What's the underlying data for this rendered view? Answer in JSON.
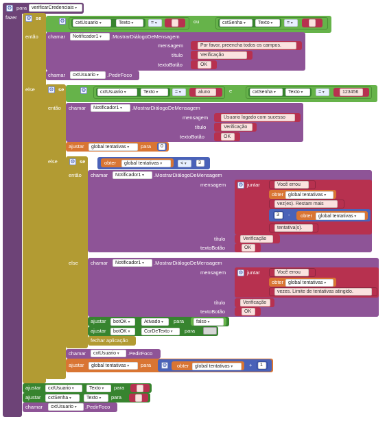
{
  "kw": {
    "para": "para",
    "fazer": "fazer",
    "se": "se",
    "entao": "então",
    "senao": "else",
    "chamar": "chamar",
    "ajustar": "ajustar",
    "obter": "obter",
    "juntar": "juntar",
    "mensagem": "mensagem",
    "titulo": "título",
    "textoBotao": "textoBotão",
    "para_set": "para",
    "e": "e",
    "ou": "ou",
    "fechar": "fechar aplicação"
  },
  "procedure": {
    "name": "verificarCredenciais"
  },
  "comp": {
    "cxtUsuario": "cxtUsuario",
    "cxtSenha": "cxtSenha",
    "notificador": "Notificador1",
    "botOK": "botOK",
    "texto": "Texto",
    "ativado": "Ativado",
    "corDeTexto": "CorDeTexto",
    "mostrarDialogo": ".MostrarDiálogoDeMensagem",
    "pedirFoco": ".PedirFoco"
  },
  "ops": {
    "eq": "=",
    "lt": "<",
    "plus": "+"
  },
  "vars": {
    "tentativas": "global tentativas"
  },
  "strings": {
    "vazio": "",
    "preencha": "Por favor, preencha todos os campos.",
    "verificacao": "Verificação",
    "ok": "OK",
    "aluno": "aluno",
    "senha": "123456",
    "logado": "Usuario logado com sucesso",
    "voceErrou": "Você errou ",
    "restam": " vez(es). Restam mais ",
    "tentativasS": " tentativa(s).",
    "limite": " vezes. Limite de tentativas atingido.",
    "falso": "falso"
  },
  "nums": {
    "zero": "0",
    "tres": "3",
    "um": "1"
  },
  "colors": {
    "procedure": "#8e5497",
    "control": "#b29b33",
    "logic": "#66b34a",
    "text": "#b7314f",
    "variable": "#d97533",
    "math": "#4a62b8",
    "component": "#37842f"
  }
}
